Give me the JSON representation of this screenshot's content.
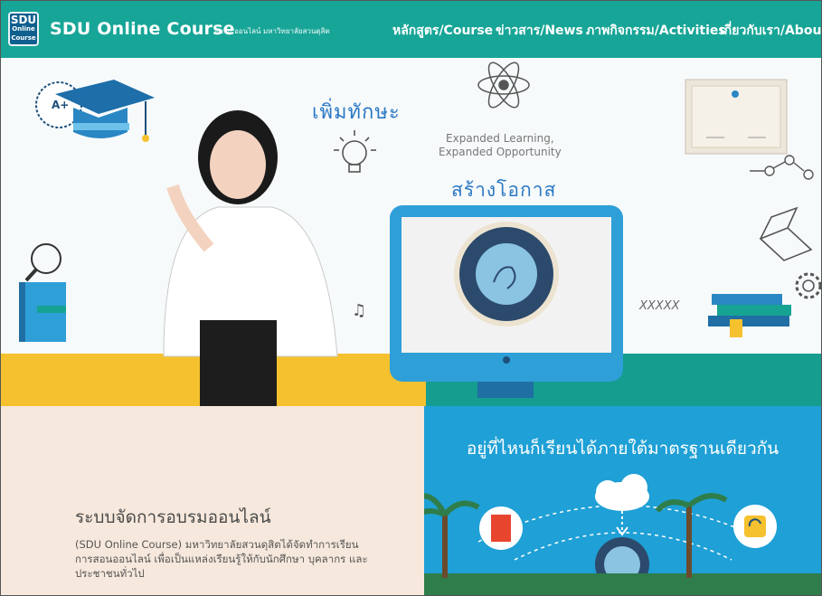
{
  "nav": {
    "logo_line1": "SDU",
    "logo_line2": "Online",
    "logo_line3": "Course",
    "title": "SDU Online Course",
    "subtitle": "อบรม ออนไลน์ มหาวิทยาลัยสวนดุสิต",
    "menu": [
      "หลักสูตร/Course",
      "ข่าวสาร/News",
      "ภาพกิจกรรม/Activities",
      "เกี่ยวกับเรา/About Us"
    ]
  },
  "hero": {
    "headline_th": "เพิ่มทักษะ",
    "tagline_en_1": "Expanded Learning,",
    "tagline_en_2": "Expanded Opportunity",
    "headline_th_2": "สร้างโอกาส",
    "badge_text": "A+",
    "seal_text": "SUAN DUSIT UNIVERSITY",
    "dna_text": "XXXXX"
  },
  "info": {
    "title": "ระบบจัดการอบรมออนไลน์",
    "body": "(SDU Online Course) มหาวิทยาลัยสวนดุสิตได้จัดทำการเรียนการสอนออนไลน์ เพื่อเป็นแหล่งเรียนรู้ให้กับนักศึกษา บุคลากร และประชาชนทั่วไป"
  },
  "campus": {
    "title": "อยู่ที่ไหนก็เรียนได้ภายใต้มาตรฐานเดียวกัน"
  },
  "colors": {
    "nav": "#17a597",
    "accent_blue": "#2b78c4",
    "yellow": "#f6c12e",
    "teal_band": "#159d8f",
    "info_bg": "#f6e8dc",
    "campus_bg": "#1fa0d6"
  }
}
